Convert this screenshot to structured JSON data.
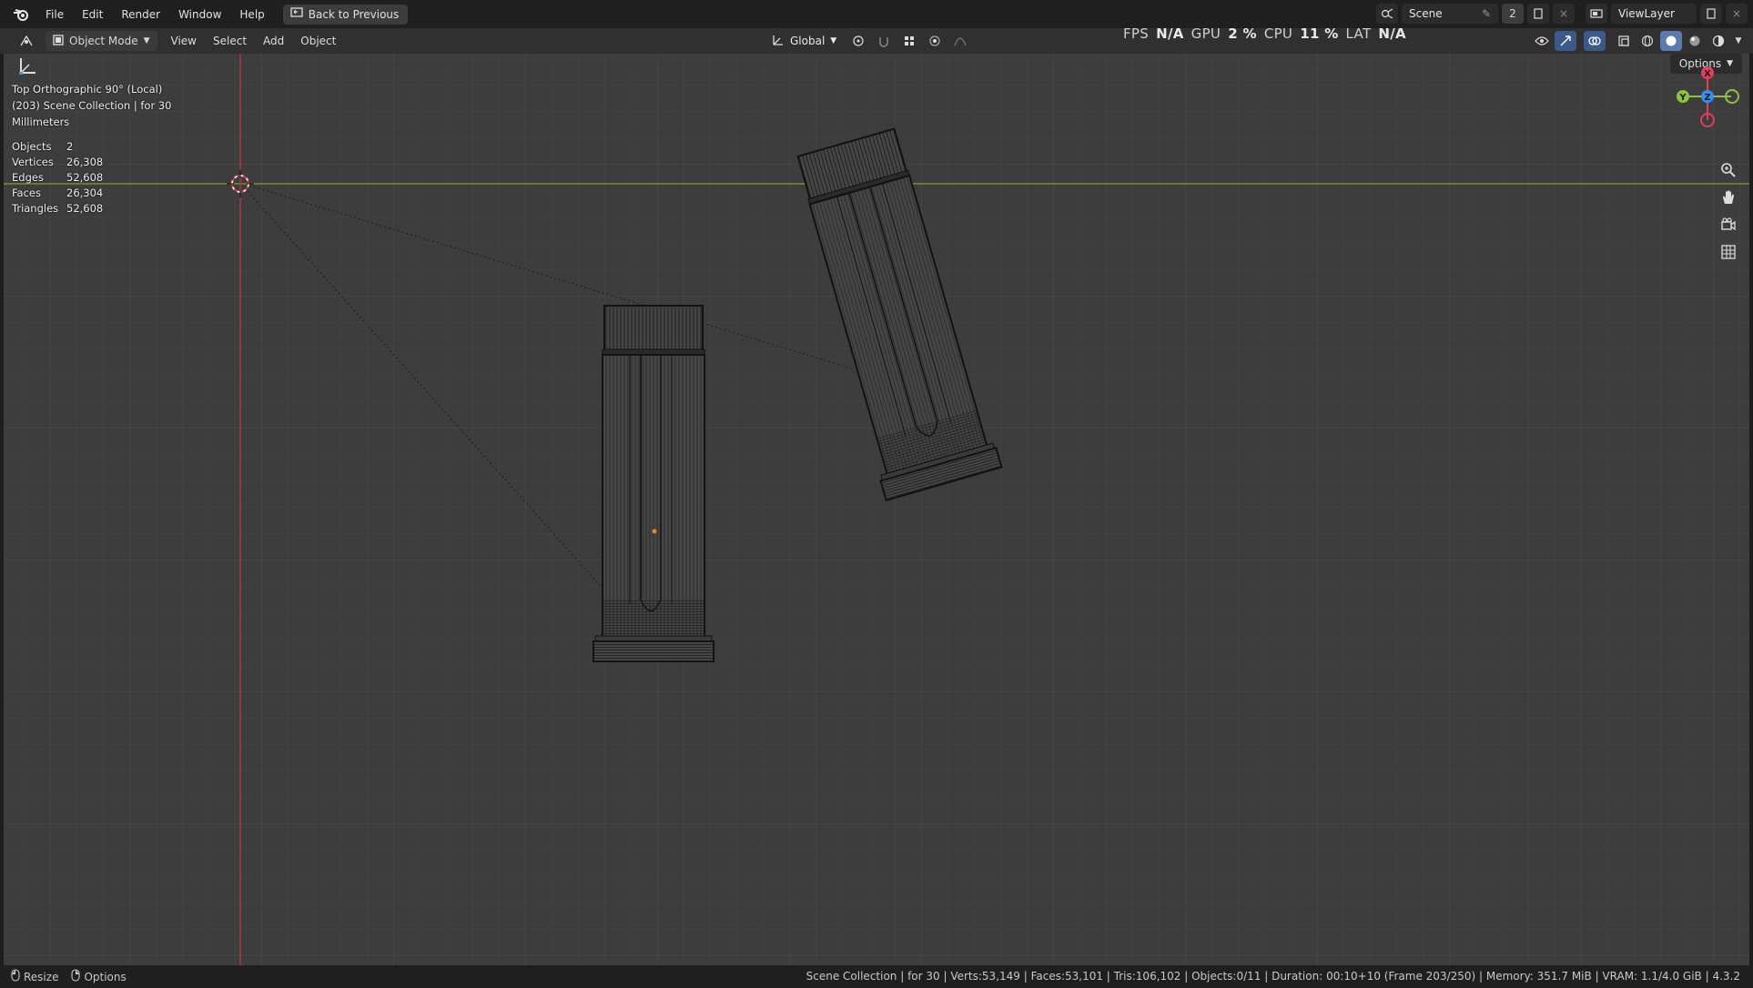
{
  "menu": {
    "items": [
      "File",
      "Edit",
      "Render",
      "Window",
      "Help"
    ],
    "back_button": "Back to Previous"
  },
  "top_right": {
    "scene_name": "Scene",
    "scene_count": "2",
    "view_layer": "ViewLayer"
  },
  "header": {
    "mode": "Object Mode",
    "items": [
      "View",
      "Select",
      "Add",
      "Object"
    ],
    "orientation": "Global"
  },
  "perf": {
    "fps_label": "FPS",
    "fps_value": "N/A",
    "gpu_label": "GPU",
    "gpu_value": "2 %",
    "cpu_label": "CPU",
    "cpu_value": "11 %",
    "lat_label": "LAT",
    "lat_value": "N/A"
  },
  "viewport": {
    "view_name": "Top Orthographic 90° (Local)",
    "collection": "(203) Scene Collection | for 30",
    "units": "Millimeters",
    "options_label": "Options",
    "stats": [
      {
        "label": "Objects",
        "value": "2"
      },
      {
        "label": "Vertices",
        "value": "26,308"
      },
      {
        "label": "Edges",
        "value": "52,608"
      },
      {
        "label": "Faces",
        "value": "26,304"
      },
      {
        "label": "Triangles",
        "value": "52,608"
      }
    ],
    "gizmo": {
      "x": "X",
      "y": "Y",
      "z": "Z"
    }
  },
  "status": {
    "resize": "Resize",
    "options": "Options",
    "info": "Scene Collection | for 30 | Verts:53,149 | Faces:53,101 | Tris:106,102 | Objects:0/11 | Duration: 00:10+10 (Frame 203/250) | Memory: 351.7 MiB | VRAM: 1.1/4.0 GiB | 4.3.2"
  },
  "colors": {
    "viewport_bg": "#3d3d3d",
    "x_axis": "#e0405a",
    "y_axis": "#8bc43a",
    "z_axis": "#3a8ef0"
  }
}
